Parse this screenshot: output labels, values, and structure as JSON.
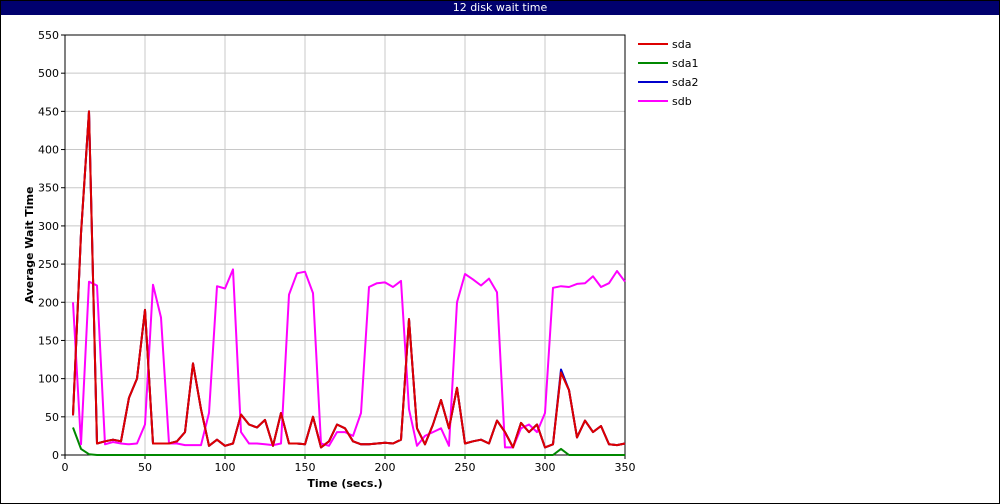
{
  "window": {
    "title": "12 disk wait time"
  },
  "chart_data": {
    "type": "line",
    "title": "12 disk wait time",
    "xlabel": "Time (secs.)",
    "ylabel": "Average Wait Time",
    "xlim": [
      0,
      350
    ],
    "ylim": [
      0,
      550
    ],
    "xticks": [
      0,
      50,
      100,
      150,
      200,
      250,
      300,
      350
    ],
    "yticks": [
      0,
      50,
      100,
      150,
      200,
      250,
      300,
      350,
      400,
      450,
      500,
      550
    ],
    "grid": true,
    "legend_position": "right",
    "x": [
      5,
      10,
      15,
      20,
      25,
      30,
      35,
      40,
      45,
      50,
      55,
      60,
      65,
      70,
      75,
      80,
      85,
      90,
      95,
      100,
      105,
      110,
      115,
      120,
      125,
      130,
      135,
      140,
      145,
      150,
      155,
      160,
      165,
      170,
      175,
      180,
      185,
      190,
      195,
      200,
      205,
      210,
      215,
      220,
      225,
      230,
      235,
      240,
      245,
      250,
      255,
      260,
      265,
      270,
      275,
      280,
      285,
      290,
      295,
      300,
      305,
      310,
      315,
      320,
      325,
      330,
      335,
      340,
      345,
      350
    ],
    "series": [
      {
        "name": "sda",
        "color": "#dd0000",
        "values": [
          52,
          290,
          450,
          15,
          18,
          20,
          18,
          75,
          100,
          190,
          15,
          15,
          15,
          18,
          30,
          120,
          60,
          12,
          20,
          12,
          15,
          53,
          40,
          36,
          46,
          12,
          55,
          15,
          15,
          14,
          50,
          10,
          18,
          40,
          35,
          18,
          14,
          14,
          15,
          16,
          15,
          20,
          178,
          35,
          14,
          40,
          72,
          35,
          88,
          15,
          18,
          20,
          15,
          45,
          30,
          10,
          42,
          30,
          40,
          10,
          14,
          108,
          85,
          23,
          45,
          30,
          38,
          14,
          13,
          15
        ]
      },
      {
        "name": "sda1",
        "color": "#008800",
        "values": [
          36,
          8,
          1,
          0,
          0,
          0,
          0,
          0,
          0,
          0,
          0,
          0,
          0,
          0,
          0,
          0,
          0,
          0,
          0,
          0,
          0,
          0,
          0,
          0,
          0,
          0,
          0,
          0,
          0,
          0,
          0,
          0,
          0,
          0,
          0,
          0,
          0,
          0,
          0,
          0,
          0,
          0,
          0,
          0,
          0,
          0,
          0,
          0,
          0,
          0,
          0,
          0,
          0,
          0,
          0,
          0,
          0,
          0,
          0,
          0,
          0,
          8,
          0,
          0,
          0,
          0,
          0,
          0,
          0,
          0
        ]
      },
      {
        "name": "sda2",
        "color": "#0000cc",
        "values": [
          52,
          290,
          450,
          15,
          18,
          20,
          18,
          75,
          100,
          190,
          15,
          15,
          15,
          18,
          30,
          120,
          60,
          12,
          20,
          12,
          15,
          53,
          40,
          36,
          46,
          12,
          55,
          15,
          15,
          14,
          50,
          10,
          18,
          40,
          35,
          18,
          14,
          14,
          15,
          16,
          15,
          20,
          178,
          35,
          14,
          40,
          72,
          35,
          88,
          15,
          18,
          20,
          15,
          45,
          30,
          10,
          42,
          30,
          40,
          10,
          14,
          112,
          85,
          23,
          45,
          30,
          38,
          14,
          13,
          15
        ]
      },
      {
        "name": "sdb",
        "color": "#ff00ff",
        "values": [
          200,
          14,
          227,
          222,
          14,
          17,
          15,
          14,
          15,
          40,
          223,
          180,
          15,
          15,
          13,
          13,
          13,
          55,
          221,
          218,
          243,
          30,
          15,
          15,
          14,
          13,
          15,
          210,
          238,
          240,
          212,
          15,
          12,
          30,
          30,
          25,
          55,
          220,
          225,
          226,
          220,
          228,
          60,
          12,
          25,
          30,
          35,
          12,
          200,
          237,
          230,
          222,
          231,
          213,
          10,
          10,
          35,
          40,
          30,
          55,
          219,
          221,
          220,
          224,
          225,
          234,
          220,
          225,
          241,
          227
        ]
      }
    ]
  }
}
